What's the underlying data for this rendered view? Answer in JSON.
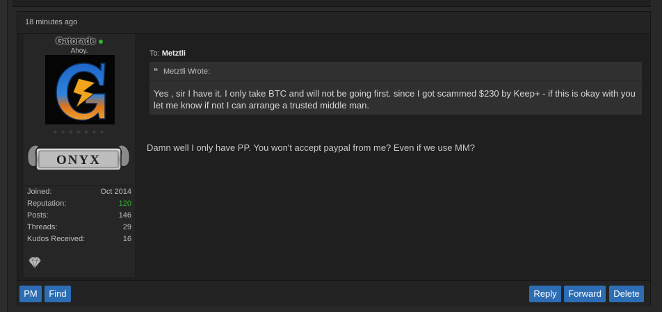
{
  "post": {
    "timestamp": "18 minutes ago",
    "author": {
      "username": "Gatorade",
      "user_title": "Ahoy.",
      "online": true,
      "rank_stars": "✦✦✦✦✦✦✦",
      "rank_badge_text": "ONYX",
      "stats": [
        {
          "label": "Joined:",
          "value": "Oct 2014"
        },
        {
          "label": "Reputation:",
          "value": "120"
        },
        {
          "label": "Posts:",
          "value": "146"
        },
        {
          "label": "Threads:",
          "value": "29"
        },
        {
          "label": "Kudos Received:",
          "value": "16"
        }
      ]
    },
    "to_label": "To:",
    "to_user": "Metztli",
    "quote": {
      "mark": "“",
      "author_line": "Metztli Wrote:",
      "text": "Yes , sir I have it. I only take BTC and will not be going first. since I got scammed $230 by Keep+ - if this is okay with you let me know if not I can arrange a trusted middle man."
    },
    "message": "Damn well I only have PP. You won't accept paypal from me? Even if we use MM?"
  },
  "buttons": {
    "pm": "PM",
    "find": "Find",
    "reply": "Reply",
    "forward": "Forward",
    "delete": "Delete"
  },
  "colors": {
    "accent": "#2d6db4",
    "online": "#2db82d",
    "reputation": "#2db82d"
  }
}
